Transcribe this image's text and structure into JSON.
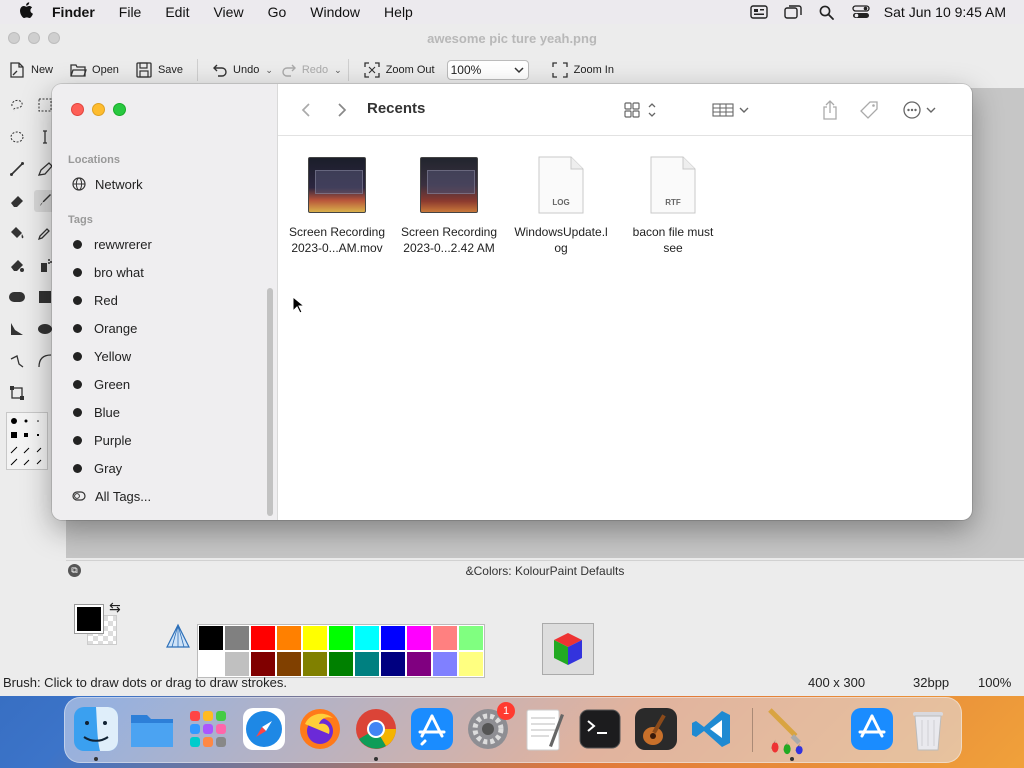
{
  "menubar": {
    "app_name": "Finder",
    "items": [
      "File",
      "Edit",
      "View",
      "Go",
      "Window",
      "Help"
    ],
    "clock": "Sat Jun 10  9:45 AM"
  },
  "kolourpaint": {
    "title": "awesome pic ture yeah.png",
    "toolbar": {
      "new": "New",
      "open": "Open",
      "save": "Save",
      "undo": "Undo",
      "redo": "Redo",
      "zoom_out": "Zoom Out",
      "zoom_value": "100%",
      "zoom_in": "Zoom In"
    },
    "colors_title": "&Colors: KolourPaint Defaults",
    "palette_top": [
      "#000000",
      "#808080",
      "#ff0000",
      "#ff8000",
      "#ffff00",
      "#00ff00",
      "#00ffff",
      "#0000ff",
      "#ff00ff",
      "#ff8080",
      "#80ff80"
    ],
    "palette_bottom": [
      "#ffffff",
      "#c0c0c0",
      "#800000",
      "#804000",
      "#808000",
      "#008000",
      "#008080",
      "#000080",
      "#800080",
      "#8080ff",
      "#ffff80"
    ],
    "status": {
      "message": "Brush: Click to draw dots or drag to draw strokes.",
      "dimensions": "400 x 300",
      "depth": "32bpp",
      "zoom": "100%"
    }
  },
  "finder": {
    "title": "Recents",
    "sidebar": {
      "locations_heading": "Locations",
      "network": "Network",
      "tags_heading": "Tags",
      "tags": [
        "rewwrerer",
        "bro what",
        "Red",
        "Orange",
        "Yellow",
        "Green",
        "Blue",
        "Purple",
        "Gray"
      ],
      "all_tags": "All Tags..."
    },
    "files": [
      {
        "line1": "Screen Recording",
        "line2": "2023-0...AM.mov",
        "kind": "video"
      },
      {
        "line1": "Screen Recording",
        "line2": "2023-0...2.42 AM",
        "kind": "video"
      },
      {
        "line1": "WindowsUpdate.l",
        "line2": "og",
        "kind": "doc",
        "badge": "LOG"
      },
      {
        "line1": "bacon file must",
        "line2": "see",
        "kind": "doc",
        "badge": "RTF"
      }
    ]
  },
  "dock": {
    "apps": [
      "finder-icon",
      "files-icon",
      "launchpad-icon",
      "safari-icon",
      "firefox-icon",
      "chrome-icon",
      "app-store-icon",
      "system-settings-icon",
      "textedit-icon",
      "terminal-icon",
      "garageband-icon",
      "vscode-icon",
      "kolourpaint-icon",
      "app-store-icon",
      "trash-icon"
    ],
    "settings_badge": "1"
  }
}
